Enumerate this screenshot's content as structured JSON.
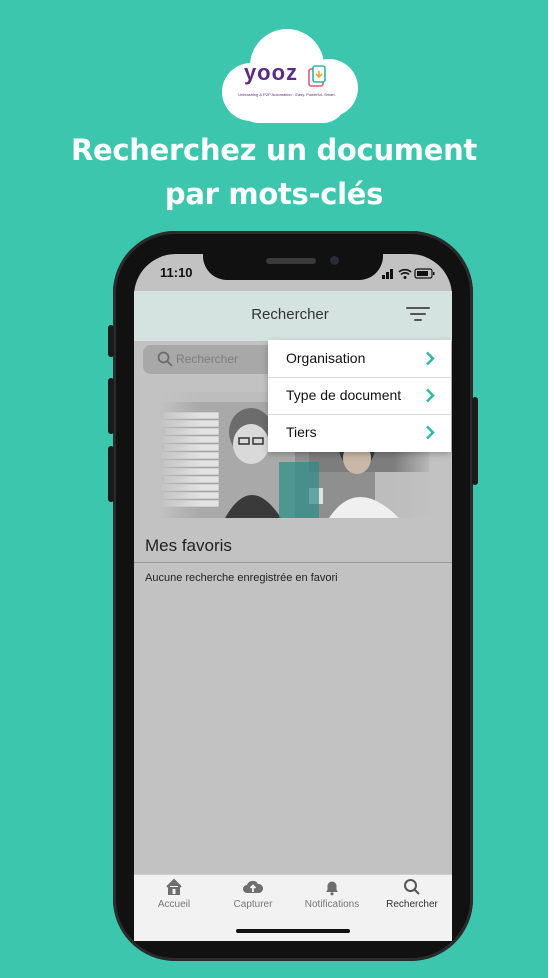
{
  "brand": {
    "name": "yooz",
    "tagline": "Unleashing & P2P Automation · Easy. Powerful. Smart.",
    "bg_color": "#3cc6ae",
    "accent": "#5a2d82"
  },
  "headline": {
    "line1": "Recherchez un document",
    "line2": "par mots-clés"
  },
  "status_bar": {
    "time": "11:10",
    "icons": "signal-wifi-battery"
  },
  "nav": {
    "title": "Rechercher",
    "filter_icon": "filter-icon"
  },
  "search": {
    "placeholder": "Rechercher"
  },
  "dropdown": {
    "items": [
      {
        "label": "Organisation"
      },
      {
        "label": "Type de document"
      },
      {
        "label": "Tiers"
      }
    ],
    "chevron_color": "#2bb8a0"
  },
  "favorites": {
    "title": "Mes favoris",
    "empty_text": "Aucune recherche enregistrée en favori"
  },
  "tabs": [
    {
      "label": "Accueil",
      "icon": "home-icon"
    },
    {
      "label": "Capturer",
      "icon": "cloud-upload-icon"
    },
    {
      "label": "Notifications",
      "icon": "bell-icon"
    },
    {
      "label": "Rechercher",
      "icon": "search-icon",
      "active": true
    }
  ]
}
